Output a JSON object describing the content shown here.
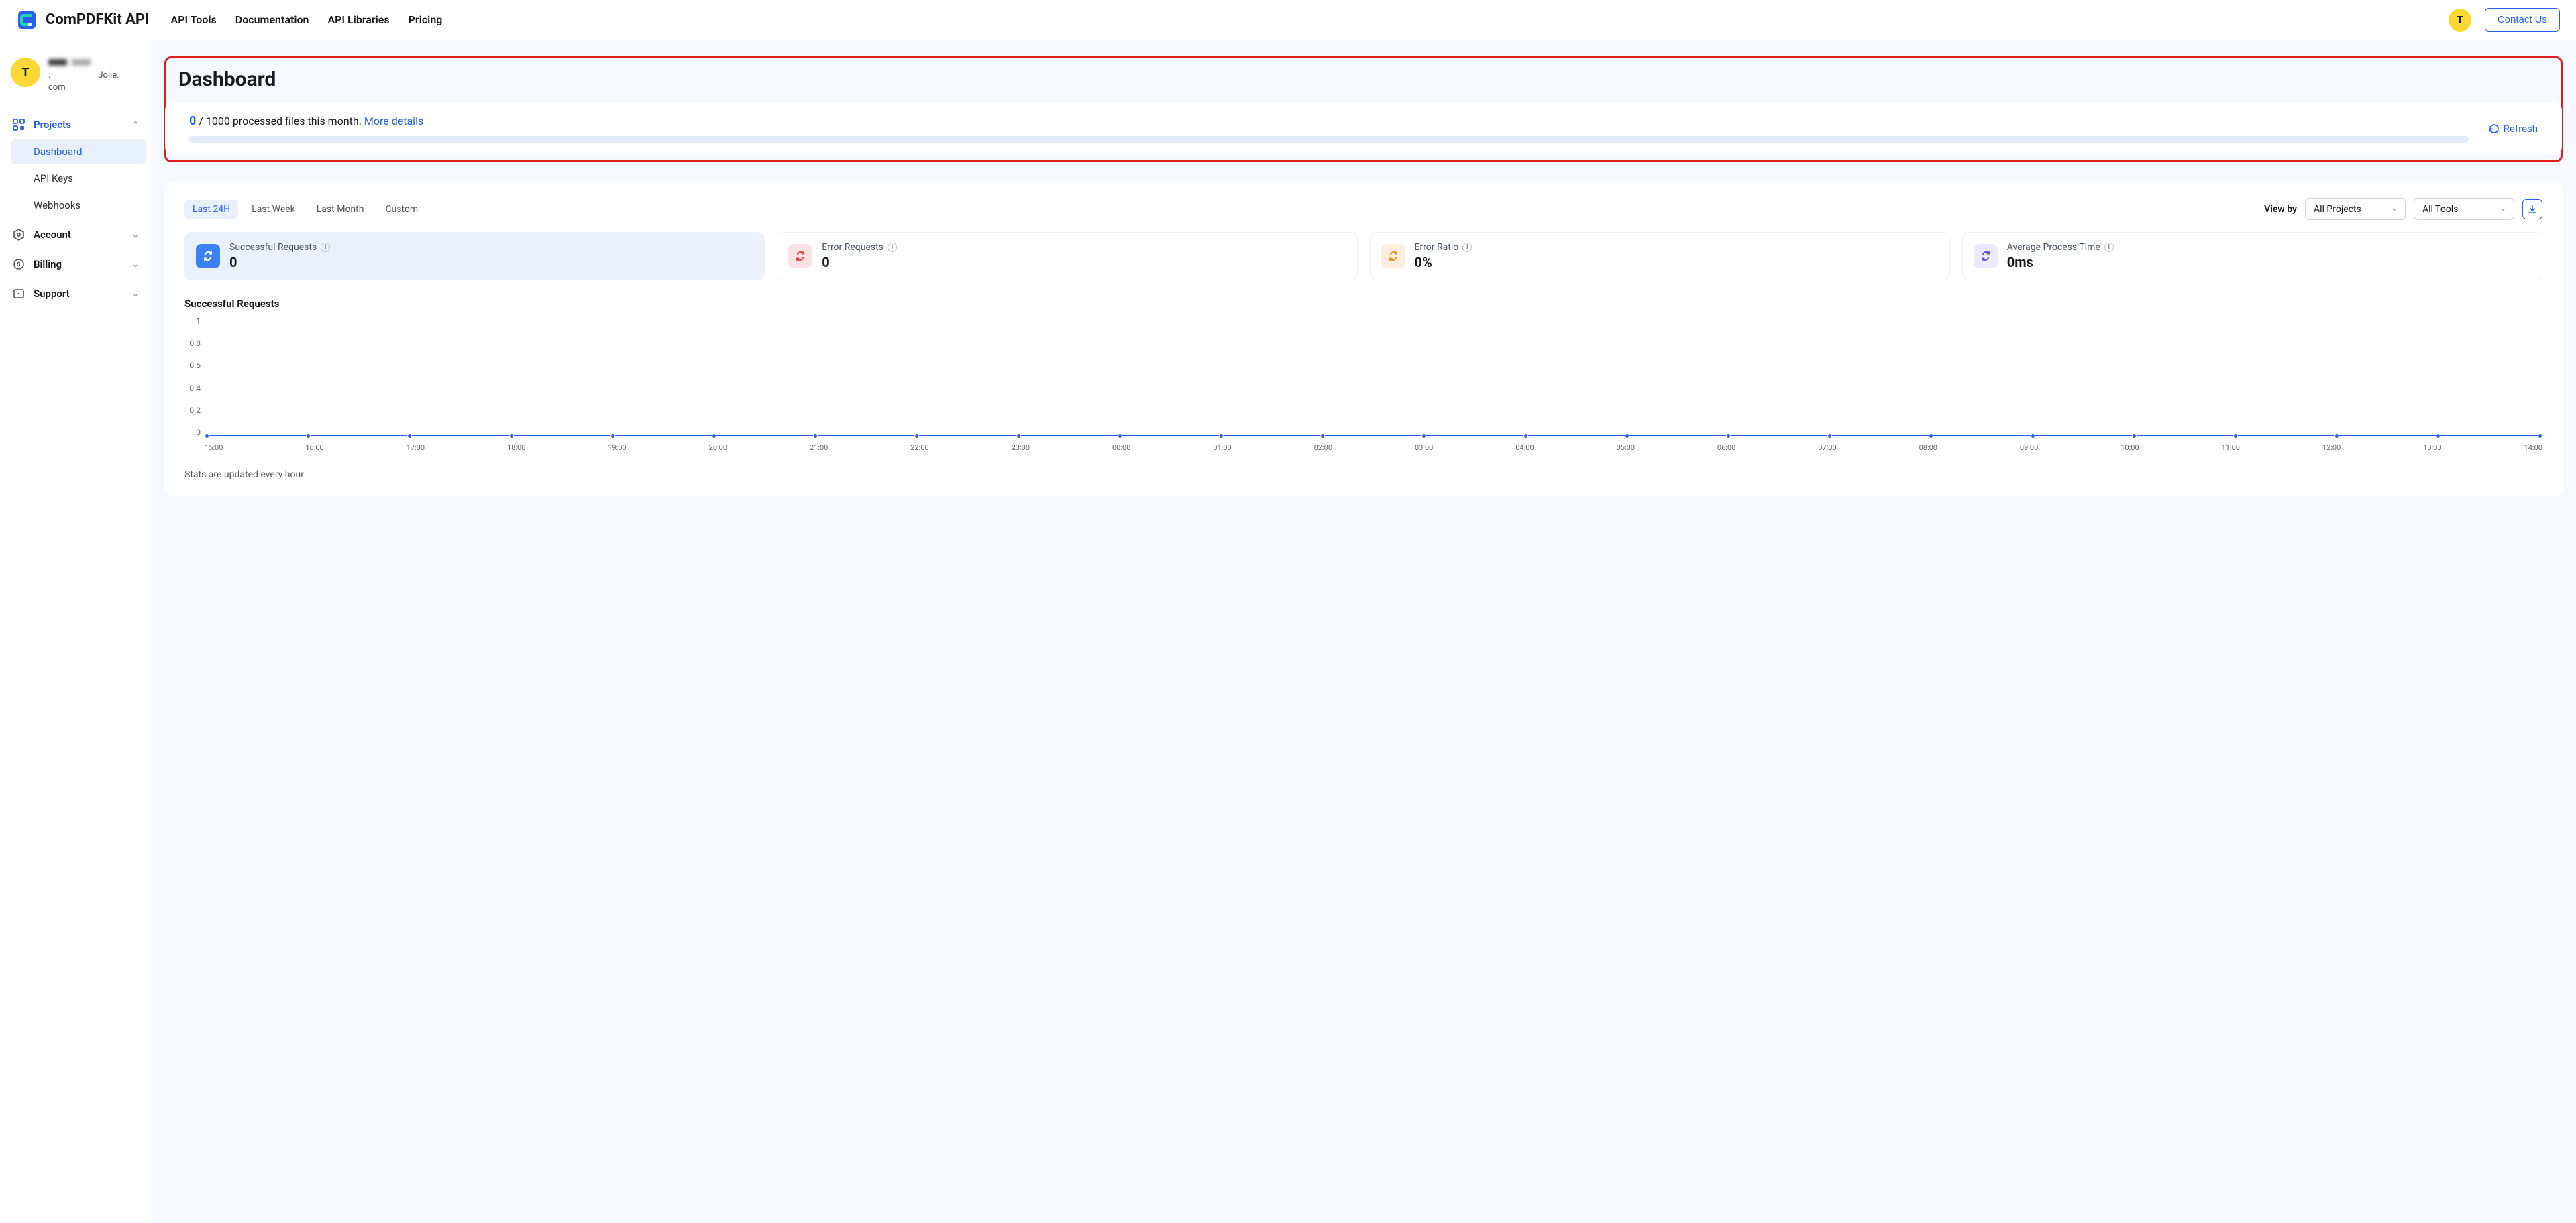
{
  "header": {
    "brand": "ComPDFKit API",
    "nav": [
      "API Tools",
      "Documentation",
      "API Libraries",
      "Pricing"
    ],
    "avatar_letter": "T",
    "contact": "Contact Us"
  },
  "sidebar": {
    "avatar_letter": "T",
    "user_line2_suffix": "Jolie.",
    "user_line3": "com",
    "sections": {
      "projects": {
        "label": "Projects",
        "items": [
          "Dashboard",
          "API Keys",
          "Webhooks"
        ]
      },
      "account": {
        "label": "Account"
      },
      "billing": {
        "label": "Billing"
      },
      "support": {
        "label": "Support"
      }
    }
  },
  "page": {
    "title": "Dashboard",
    "usage": {
      "count": "0",
      "sep": " / ",
      "limit_text": "1000 processed files this month.",
      "more": "More details"
    },
    "refresh": "Refresh"
  },
  "stats_panel": {
    "ranges": [
      "Last 24H",
      "Last Week",
      "Last Month",
      "Custom"
    ],
    "viewby_label": "View by",
    "select_projects": "All Projects",
    "select_tools": "All Tools",
    "stats": [
      {
        "label": "Successful Requests",
        "value": "0"
      },
      {
        "label": "Error Requests",
        "value": "0"
      },
      {
        "label": "Error Ratio",
        "value": "0%"
      },
      {
        "label": "Average Process Time",
        "value": "0ms"
      }
    ],
    "chart_section_title": "Successful Requests",
    "footnote": "Stats are updated every hour"
  },
  "chart_data": {
    "type": "line",
    "title": "Successful Requests",
    "xlabel": "",
    "ylabel": "",
    "ylim": [
      0,
      1
    ],
    "y_ticks": [
      "1",
      "0.8",
      "0.6",
      "0.4",
      "0.2",
      "0"
    ],
    "categories": [
      "15:00",
      "16:00",
      "17:00",
      "18:00",
      "19:00",
      "20:00",
      "21:00",
      "22:00",
      "23:00",
      "00:00",
      "01:00",
      "02:00",
      "03:00",
      "04:00",
      "05:00",
      "06:00",
      "07:00",
      "08:00",
      "09:00",
      "10:00",
      "11:00",
      "12:00",
      "13:00",
      "14:00"
    ],
    "series": [
      {
        "name": "Successful Requests",
        "values": [
          0,
          0,
          0,
          0,
          0,
          0,
          0,
          0,
          0,
          0,
          0,
          0,
          0,
          0,
          0,
          0,
          0,
          0,
          0,
          0,
          0,
          0,
          0,
          0
        ]
      }
    ]
  }
}
